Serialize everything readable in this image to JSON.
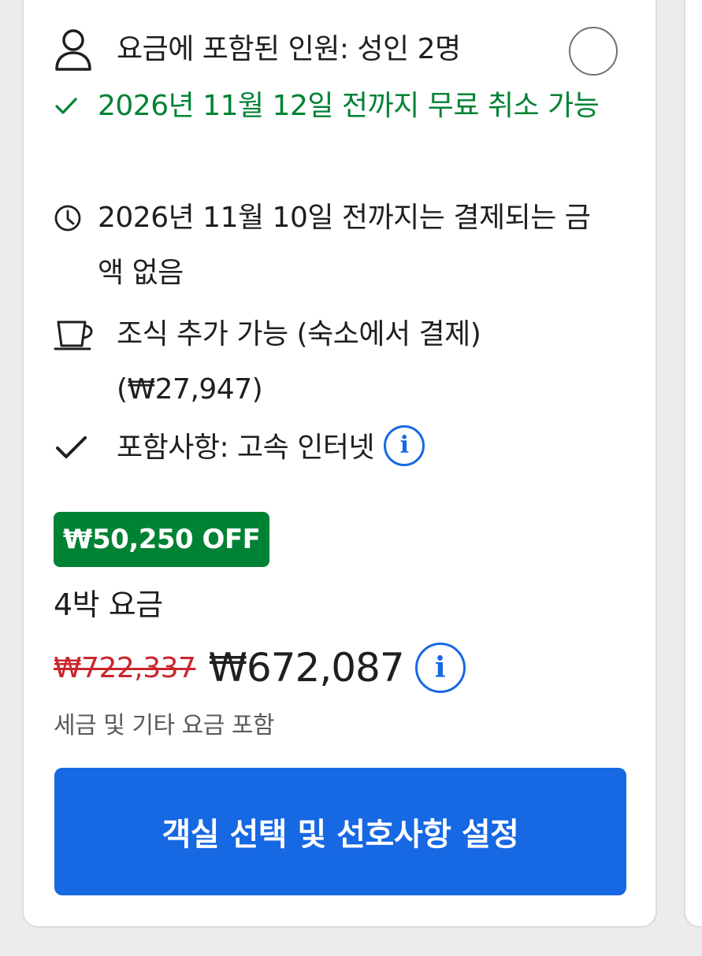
{
  "offer": {
    "occupancy": "요금에 포함된 인원: 성인 2명",
    "cancellation": "2026년 11월 12일 전까지 무료 취소 가능",
    "payment": "2026년 11월 10일 전까지는 결제되는 금액 없음",
    "breakfast": "조식 추가 가능 (숙소에서 결제) (₩27,947)",
    "amenity": "포함사항: 고속 인터넷",
    "info_symbol": "i"
  },
  "pricing": {
    "discount_badge": "₩50,250 OFF",
    "nights_label": "4박 요금",
    "original_price": "₩722,337",
    "current_price": "₩672,087",
    "taxes_note": "세금 및 기타 요금 포함"
  },
  "cta": {
    "label": "객실 선택 및 선호사항 설정"
  },
  "icons": {
    "occupancy": "person-icon",
    "cancellation": "checkmark-icon",
    "payment": "clock-icon",
    "breakfast": "coffee-cup-icon",
    "amenity": "checkmark-icon",
    "info": "info-icon"
  },
  "colors": {
    "accent": "#1668e3",
    "success": "#008234",
    "strike": "#c9252d"
  }
}
